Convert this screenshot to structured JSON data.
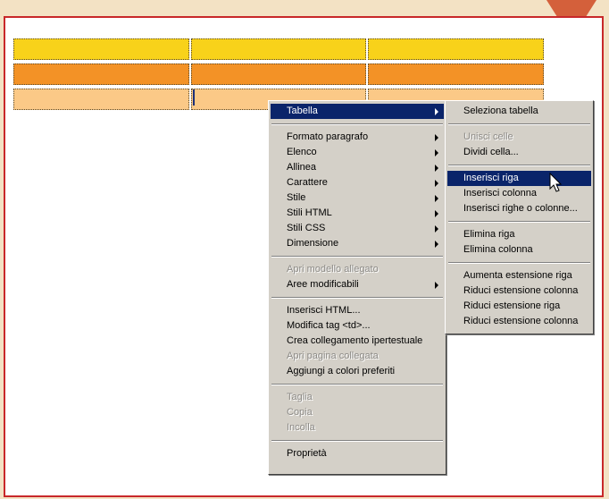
{
  "table": {
    "rows": [
      {
        "color": "#f8d21a",
        "cells": 3
      },
      {
        "color": "#f39226",
        "cells": 3
      },
      {
        "color": "#fbc987",
        "cells": 3
      }
    ]
  },
  "context_menu": {
    "items": [
      {
        "label": "Tabella",
        "submenu": true,
        "state": "highlighted"
      },
      {
        "separator": true
      },
      {
        "label": "Formato paragrafo",
        "submenu": true
      },
      {
        "label": "Elenco",
        "submenu": true
      },
      {
        "label": "Allinea",
        "submenu": true
      },
      {
        "label": "Carattere",
        "submenu": true
      },
      {
        "label": "Stile",
        "submenu": true
      },
      {
        "label": "Stili HTML",
        "submenu": true
      },
      {
        "label": "Stili CSS",
        "submenu": true
      },
      {
        "label": "Dimensione",
        "submenu": true
      },
      {
        "separator": true
      },
      {
        "label": "Apri modello allegato",
        "state": "disabled"
      },
      {
        "label": "Aree modificabili",
        "submenu": true
      },
      {
        "separator": true
      },
      {
        "label": "Inserisci HTML..."
      },
      {
        "label": "Modifica tag <td>..."
      },
      {
        "label": "Crea collegamento ipertestuale"
      },
      {
        "label": "Apri pagina collegata",
        "state": "disabled"
      },
      {
        "label": "Aggiungi a colori preferiti"
      },
      {
        "separator": true
      },
      {
        "label": "Taglia",
        "state": "disabled"
      },
      {
        "label": "Copia",
        "state": "disabled"
      },
      {
        "label": "Incolla",
        "state": "disabled"
      },
      {
        "separator": true
      },
      {
        "label": "Proprietà"
      }
    ]
  },
  "submenu": {
    "items": [
      {
        "label": "Seleziona tabella"
      },
      {
        "separator": true
      },
      {
        "label": "Unisci celle",
        "state": "disabled"
      },
      {
        "label": "Dividi cella..."
      },
      {
        "separator": true
      },
      {
        "label": "Inserisci riga",
        "state": "highlighted"
      },
      {
        "label": "Inserisci colonna"
      },
      {
        "label": "Inserisci righe o colonne..."
      },
      {
        "separator": true
      },
      {
        "label": "Elimina riga"
      },
      {
        "label": "Elimina colonna"
      },
      {
        "separator": true
      },
      {
        "label": "Aumenta estensione riga"
      },
      {
        "label": "Riduci estensione colonna"
      },
      {
        "label": "Riduci estensione riga"
      },
      {
        "label": "Riduci estensione colonna"
      }
    ]
  },
  "colors": {
    "background": "#f3e2c4",
    "frame_border": "#c8282a",
    "corner_arrow": "#d4603b",
    "menu_highlight": "#0a246a"
  }
}
